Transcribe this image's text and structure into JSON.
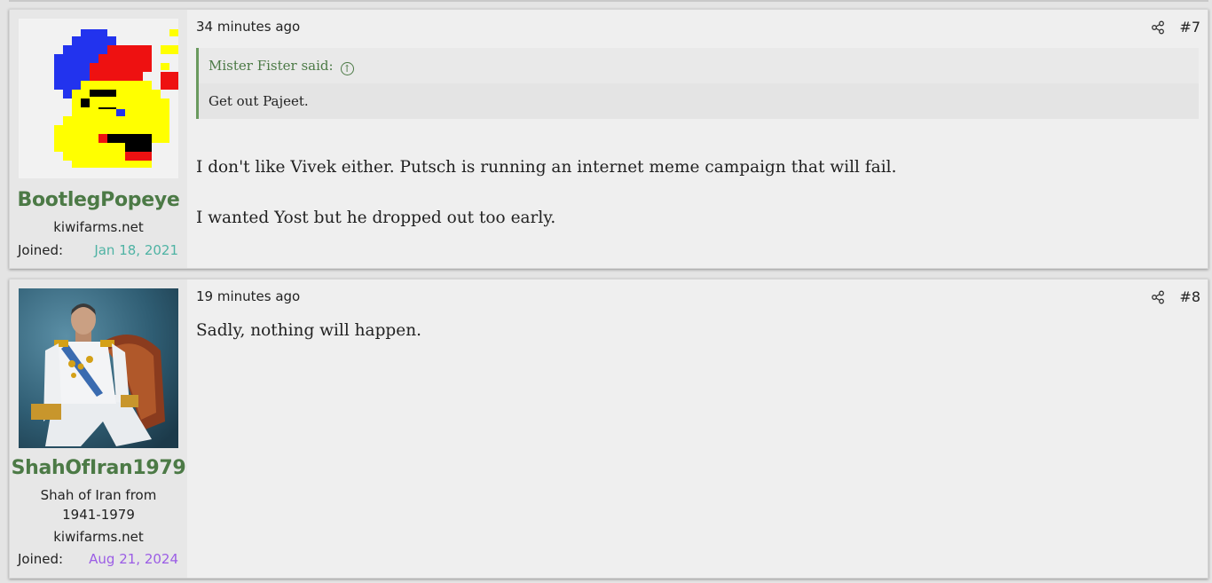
{
  "posts": [
    {
      "username": "BootlegPopeye",
      "user_lines": [
        "kiwifarms.net"
      ],
      "joined_label": "Joined:",
      "joined_date": "Jan 18, 2021",
      "joined_color": "#4fb3a4",
      "time": "34 minutes ago",
      "post_number": "#7",
      "quote": {
        "author": "Mister Fister said:",
        "text": "Get out Pajeet."
      },
      "paragraphs": [
        "I don't like Vivek either. Putsch is running an internet meme campaign that will fail.",
        "I wanted Yost but he dropped out too early."
      ]
    },
    {
      "username": "ShahOfIran1979",
      "user_title": "Shah of Iran from 1941-1979",
      "user_title_line1": "Shah of Iran from",
      "user_title_line2": "1941-1979",
      "user_lines": [
        "kiwifarms.net"
      ],
      "joined_label": "Joined:",
      "joined_date": "Aug 21, 2024",
      "joined_color": "#9b5de5",
      "time": "19 minutes ago",
      "post_number": "#8",
      "paragraphs": [
        "Sadly, nothing will happen."
      ]
    }
  ],
  "colors": {
    "username": "#4c7a46",
    "quote_border": "#6a9a5e",
    "background": "#efefef"
  },
  "icons": {
    "share": "share-icon",
    "quote_jump": "arrow-up-circle-icon"
  }
}
